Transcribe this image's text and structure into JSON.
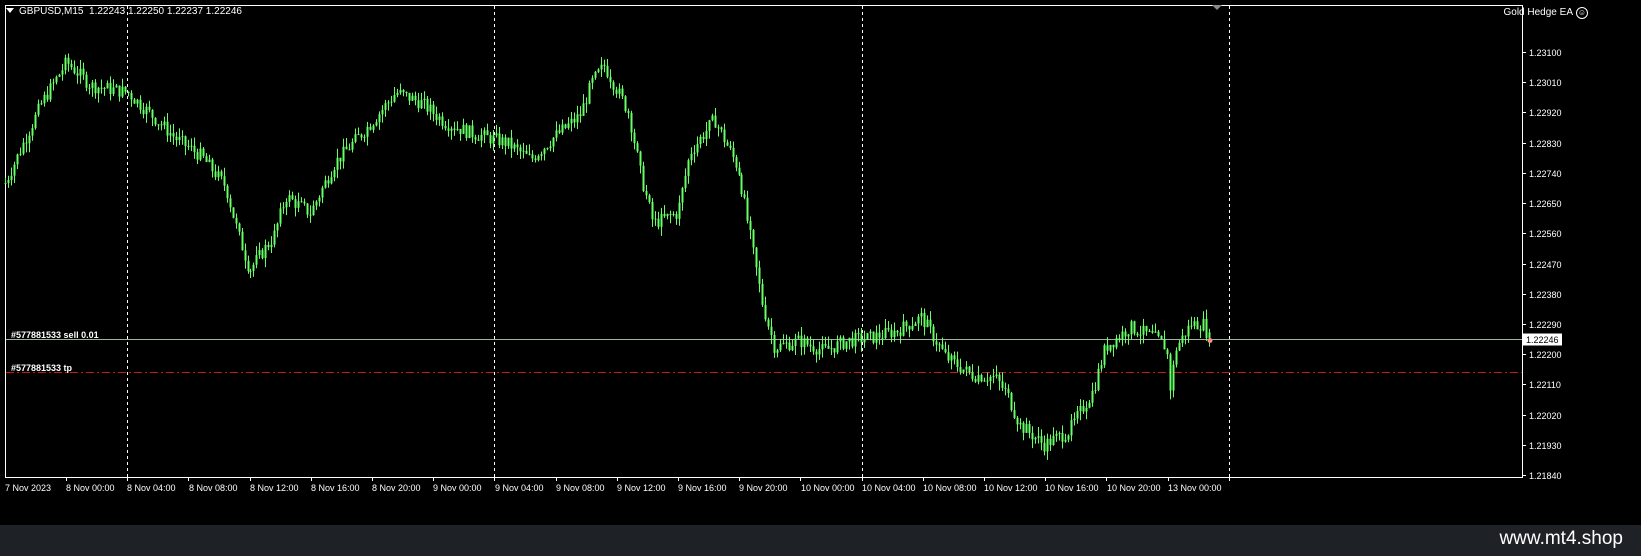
{
  "header": {
    "symbol": "GBPUSD,M15",
    "quote": "1.22243 1.22250 1.22237 1.22246"
  },
  "expert": {
    "name": "Gold Hedge EA",
    "icon": "smiley-icon"
  },
  "orders": {
    "sell_label": "#577881533 sell 0.01",
    "tp_label": "#577881533 tp",
    "sell_level": 1.22246,
    "tp_level": 1.22146
  },
  "current_price_label": "1.22246",
  "footer": {
    "site": "www.mt4.shop"
  },
  "colors": {
    "background": "#000000",
    "candles": "#66ff66",
    "grid": "#ffffff",
    "sell_line": "#9fb39f",
    "tp_line": "#d01515",
    "footer_bg": "#1e2126"
  },
  "chart_data": {
    "type": "candlestick",
    "symbol": "GBPUSD",
    "timeframe": "M15",
    "ylim": [
      1.2184,
      1.2315
    ],
    "y_ticks": [
      "1.23100",
      "1.23010",
      "1.22920",
      "1.22830",
      "1.22740",
      "1.22650",
      "1.22560",
      "1.22470",
      "1.22380",
      "1.22290",
      "1.22200",
      "1.22110",
      "1.22020",
      "1.21930",
      "1.21840"
    ],
    "x_ticks": [
      "7 Nov 2023",
      "8 Nov 00:00",
      "8 Nov 04:00",
      "8 Nov 08:00",
      "8 Nov 12:00",
      "8 Nov 16:00",
      "8 Nov 20:00",
      "9 Nov 00:00",
      "9 Nov 04:00",
      "9 Nov 08:00",
      "9 Nov 12:00",
      "9 Nov 16:00",
      "9 Nov 20:00",
      "10 Nov 00:00",
      "10 Nov 04:00",
      "10 Nov 08:00",
      "10 Nov 12:00",
      "10 Nov 16:00",
      "10 Nov 20:00",
      "13 Nov 00:00"
    ],
    "day_separators": [
      "8 Nov 00:00",
      "9 Nov 00:00",
      "10 Nov 00:00",
      "13 Nov 00:00"
    ],
    "close_path": [
      [
        0,
        1.2271
      ],
      [
        3,
        1.2295
      ],
      [
        5,
        1.2307
      ],
      [
        7,
        1.23
      ],
      [
        10,
        1.2298
      ],
      [
        12,
        1.2291
      ],
      [
        14,
        1.2284
      ],
      [
        16,
        1.2279
      ],
      [
        18,
        1.227
      ],
      [
        19,
        1.2256
      ],
      [
        20,
        1.2245
      ],
      [
        22,
        1.2255
      ],
      [
        23,
        1.2267
      ],
      [
        25,
        1.2262
      ],
      [
        27,
        1.2277
      ],
      [
        30,
        1.2289
      ],
      [
        32,
        1.2298
      ],
      [
        34,
        1.2295
      ],
      [
        36,
        1.2289
      ],
      [
        38,
        1.2286
      ],
      [
        41,
        1.2283
      ],
      [
        43,
        1.2278
      ],
      [
        45,
        1.2285
      ],
      [
        47,
        1.2291
      ],
      [
        48,
        1.2301
      ],
      [
        49,
        1.2306
      ],
      [
        51,
        1.2292
      ],
      [
        52,
        1.2273
      ],
      [
        53,
        1.2259
      ],
      [
        55,
        1.2262
      ],
      [
        56,
        1.228
      ],
      [
        58,
        1.229
      ],
      [
        60,
        1.2275
      ],
      [
        61,
        1.2255
      ],
      [
        62,
        1.2235
      ],
      [
        63,
        1.2222
      ],
      [
        65,
        1.2224
      ],
      [
        67,
        1.2221
      ],
      [
        69,
        1.2224
      ],
      [
        71,
        1.2225
      ],
      [
        73,
        1.2227
      ],
      [
        75,
        1.2231
      ],
      [
        77,
        1.2219
      ],
      [
        79,
        1.2214
      ],
      [
        81,
        1.2213
      ],
      [
        82,
        1.2208
      ],
      [
        83,
        1.2199
      ],
      [
        85,
        1.2193
      ],
      [
        87,
        1.2197
      ],
      [
        89,
        1.2209
      ],
      [
        90,
        1.2222
      ],
      [
        92,
        1.2228
      ],
      [
        94,
        1.2225
      ],
      [
        95,
        1.2222
      ],
      [
        95.3,
        1.221
      ],
      [
        95.8,
        1.2222
      ],
      [
        97,
        1.2229
      ],
      [
        98,
        1.2229
      ],
      [
        98.5,
        1.22246
      ]
    ]
  }
}
